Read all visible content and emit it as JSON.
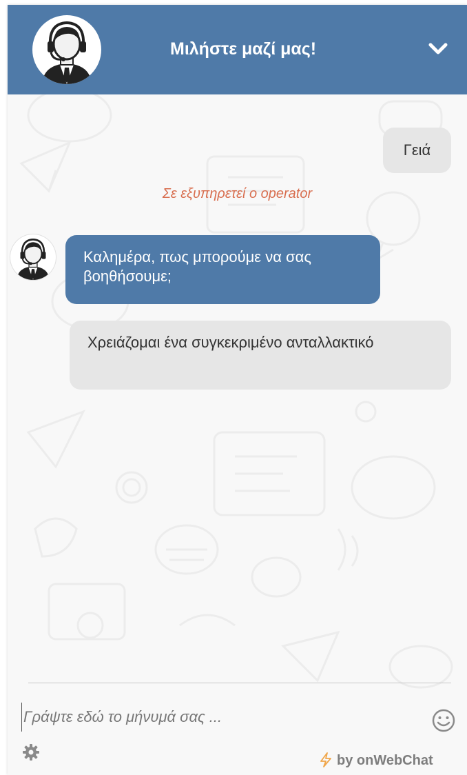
{
  "colors": {
    "header_bg": "#4f7aa8",
    "operator_bubble": "#4f7aa8",
    "user_bubble": "#e6e6e6",
    "system_note": "#d86e4f",
    "chat_bg": "#f8f8f8"
  },
  "header": {
    "title": "Μιλήστε μαζί μας!",
    "avatar_icon": "support-agent-icon",
    "collapse_icon": "chevron-down-icon"
  },
  "messages": [
    {
      "from": "user",
      "text": "Γειά"
    },
    {
      "from": "system",
      "text": "Σε εξυπηρετεί ο operator"
    },
    {
      "from": "operator",
      "text": "Καλημέρα, πως μπορούμε να σας βοηθήσουμε;"
    },
    {
      "from": "user",
      "text": "Χρειάζομαι ένα συγκεκριμένο ανταλλακτικό"
    }
  ],
  "composer": {
    "placeholder": "Γράψτε εδώ το μήνυμά σας ...",
    "value": "",
    "emoji_icon": "smiley-icon",
    "settings_icon": "gear-icon"
  },
  "branding": {
    "text": "by onWebChat",
    "icon": "lightning-icon"
  }
}
